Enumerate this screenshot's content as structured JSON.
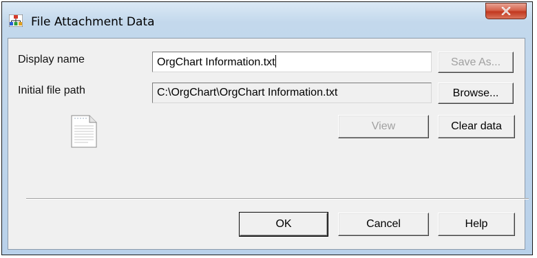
{
  "window": {
    "title": "File Attachment Data",
    "close_label": "X"
  },
  "form": {
    "display_name_label": "Display name",
    "display_name_value": "OrgChart Information.txt",
    "initial_path_label": "Initial file path",
    "initial_path_value": "C:\\OrgChart\\OrgChart Information.txt"
  },
  "buttons": {
    "save_as": "Save As...",
    "browse": "Browse...",
    "view": "View",
    "clear_data": "Clear data",
    "ok": "OK",
    "cancel": "Cancel",
    "help": "Help"
  },
  "icons": {
    "app": "orgchart-app-icon",
    "attachment": "text-document-icon"
  },
  "colors": {
    "close_button": "#c2381f",
    "disabled_text": "#a0a0a0"
  }
}
